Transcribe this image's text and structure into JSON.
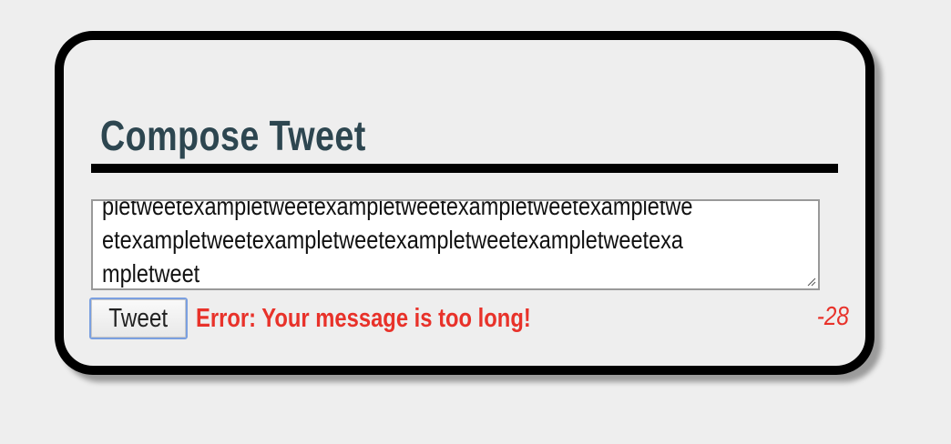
{
  "compose": {
    "title": "Compose Tweet",
    "textarea_lines": [
      "pletweetexampletweetexampletweetexampletweetexampletwe",
      "etexampletweetexampletweetexampletweetexampletweetexa",
      "mpletweet"
    ],
    "tweet_button_label": "Tweet",
    "error_message": "Error: Your message is too long!",
    "remaining_count": "-28"
  },
  "colors": {
    "title": "#2d4650",
    "error": "#e8322a",
    "button_focus": "#7a9fe0"
  }
}
